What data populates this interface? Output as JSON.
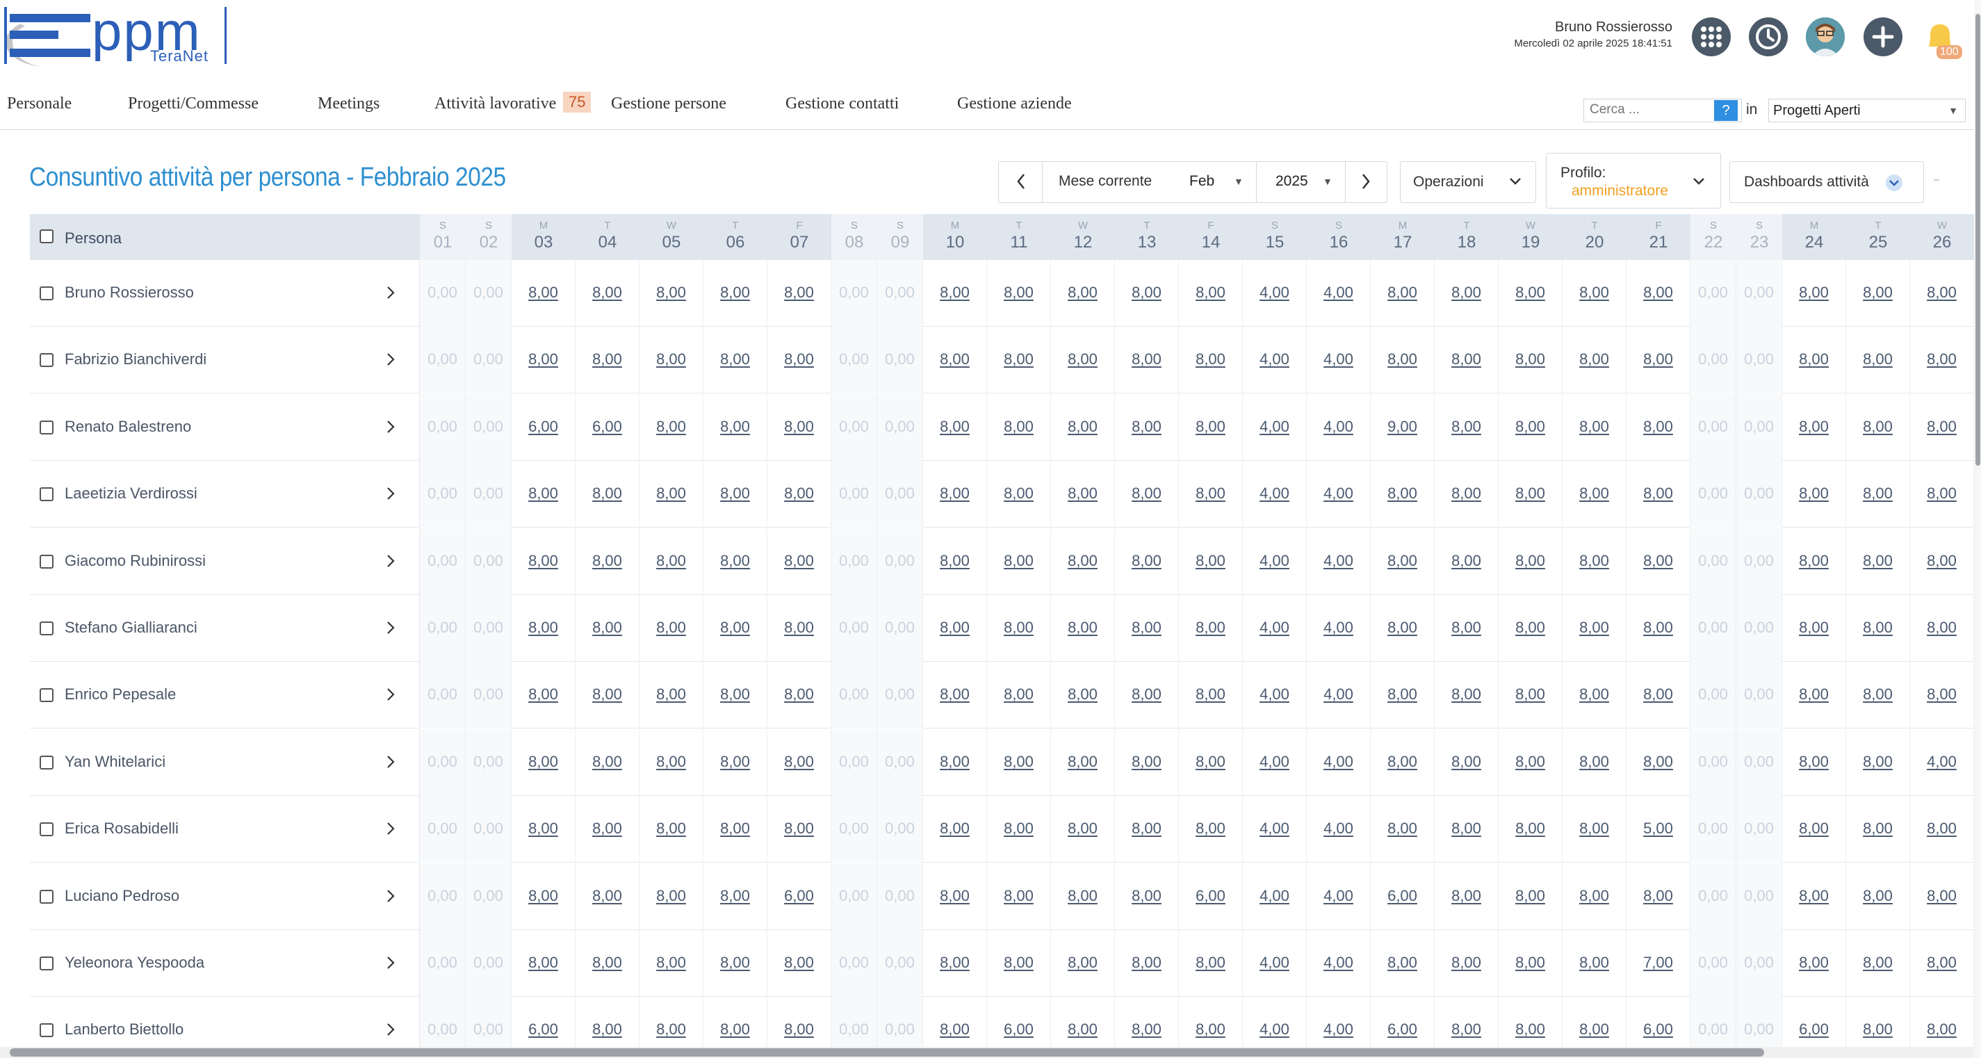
{
  "header": {
    "logo_text": "ppm",
    "logo_sub": "TeraNet",
    "user_name": "Bruno Rossierosso",
    "user_datetime": "Mercoledì 02 aprile 2025 18:41:51",
    "notifications_count": "100"
  },
  "nav": {
    "items": [
      "Personale",
      "Progetti/Commesse",
      "Meetings",
      "Attività lavorative",
      "Gestione persone",
      "Gestione contatti",
      "Gestione aziende"
    ],
    "attivita_badge": "75",
    "search_placeholder": "Cerca ...",
    "help_label": "?",
    "in_label": "in",
    "scope_selected": "Progetti Aperti"
  },
  "page": {
    "title": "Consuntivo attività per persona - Febbraio 2025",
    "current_month_label": "Mese corrente",
    "month": "Feb",
    "year": "2025",
    "operations_label": "Operazioni",
    "profile_label": "Profilo:",
    "profile_value": "amministratore",
    "dashboards_label": "Dashboards attività"
  },
  "grid": {
    "persona_header": "Persona",
    "days": [
      {
        "l": "S",
        "n": "01",
        "we": true
      },
      {
        "l": "S",
        "n": "02",
        "we": true
      },
      {
        "l": "M",
        "n": "03"
      },
      {
        "l": "T",
        "n": "04"
      },
      {
        "l": "W",
        "n": "05"
      },
      {
        "l": "T",
        "n": "06"
      },
      {
        "l": "F",
        "n": "07"
      },
      {
        "l": "S",
        "n": "08",
        "we": true
      },
      {
        "l": "S",
        "n": "09",
        "we": true
      },
      {
        "l": "M",
        "n": "10"
      },
      {
        "l": "T",
        "n": "11"
      },
      {
        "l": "W",
        "n": "12"
      },
      {
        "l": "T",
        "n": "13"
      },
      {
        "l": "F",
        "n": "14"
      },
      {
        "l": "S",
        "n": "15",
        "sat": true
      },
      {
        "l": "S",
        "n": "16",
        "sat": true
      },
      {
        "l": "M",
        "n": "17"
      },
      {
        "l": "T",
        "n": "18"
      },
      {
        "l": "W",
        "n": "19"
      },
      {
        "l": "T",
        "n": "20"
      },
      {
        "l": "F",
        "n": "21"
      },
      {
        "l": "S",
        "n": "22",
        "we": true
      },
      {
        "l": "S",
        "n": "23",
        "we": true
      },
      {
        "l": "M",
        "n": "24"
      },
      {
        "l": "T",
        "n": "25"
      },
      {
        "l": "W",
        "n": "26"
      }
    ],
    "rows": [
      {
        "name": "Bruno Rossierosso",
        "v": [
          "0,00",
          "0,00",
          "8,00",
          "8,00",
          "8,00",
          "8,00",
          "8,00",
          "0,00",
          "0,00",
          "8,00",
          "8,00",
          "8,00",
          "8,00",
          "8,00",
          "4,00",
          "4,00",
          "8,00",
          "8,00",
          "8,00",
          "8,00",
          "8,00",
          "0,00",
          "0,00",
          "8,00",
          "8,00",
          "8,00"
        ]
      },
      {
        "name": "Fabrizio Bianchiverdi",
        "v": [
          "0,00",
          "0,00",
          "8,00",
          "8,00",
          "8,00",
          "8,00",
          "8,00",
          "0,00",
          "0,00",
          "8,00",
          "8,00",
          "8,00",
          "8,00",
          "8,00",
          "4,00",
          "4,00",
          "8,00",
          "8,00",
          "8,00",
          "8,00",
          "8,00",
          "0,00",
          "0,00",
          "8,00",
          "8,00",
          "8,00"
        ]
      },
      {
        "name": "Renato Balestreno",
        "v": [
          "0,00",
          "0,00",
          "6,00",
          "6,00",
          "8,00",
          "8,00",
          "8,00",
          "0,00",
          "0,00",
          "8,00",
          "8,00",
          "8,00",
          "8,00",
          "8,00",
          "4,00",
          "4,00",
          "9,00",
          "8,00",
          "8,00",
          "8,00",
          "8,00",
          "0,00",
          "0,00",
          "8,00",
          "8,00",
          "8,00"
        ]
      },
      {
        "name": "Laeetizia Verdirossi",
        "v": [
          "0,00",
          "0,00",
          "8,00",
          "8,00",
          "8,00",
          "8,00",
          "8,00",
          "0,00",
          "0,00",
          "8,00",
          "8,00",
          "8,00",
          "8,00",
          "8,00",
          "4,00",
          "4,00",
          "8,00",
          "8,00",
          "8,00",
          "8,00",
          "8,00",
          "0,00",
          "0,00",
          "8,00",
          "8,00",
          "8,00"
        ]
      },
      {
        "name": "Giacomo Rubinirossi",
        "v": [
          "0,00",
          "0,00",
          "8,00",
          "8,00",
          "8,00",
          "8,00",
          "8,00",
          "0,00",
          "0,00",
          "8,00",
          "8,00",
          "8,00",
          "8,00",
          "8,00",
          "4,00",
          "4,00",
          "8,00",
          "8,00",
          "8,00",
          "8,00",
          "8,00",
          "0,00",
          "0,00",
          "8,00",
          "8,00",
          "8,00"
        ]
      },
      {
        "name": "Stefano Gialliaranci",
        "v": [
          "0,00",
          "0,00",
          "8,00",
          "8,00",
          "8,00",
          "8,00",
          "8,00",
          "0,00",
          "0,00",
          "8,00",
          "8,00",
          "8,00",
          "8,00",
          "8,00",
          "4,00",
          "4,00",
          "8,00",
          "8,00",
          "8,00",
          "8,00",
          "8,00",
          "0,00",
          "0,00",
          "8,00",
          "8,00",
          "8,00"
        ]
      },
      {
        "name": "Enrico Pepesale",
        "v": [
          "0,00",
          "0,00",
          "8,00",
          "8,00",
          "8,00",
          "8,00",
          "8,00",
          "0,00",
          "0,00",
          "8,00",
          "8,00",
          "8,00",
          "8,00",
          "8,00",
          "4,00",
          "4,00",
          "8,00",
          "8,00",
          "8,00",
          "8,00",
          "8,00",
          "0,00",
          "0,00",
          "8,00",
          "8,00",
          "8,00"
        ]
      },
      {
        "name": "Yan Whitelarici",
        "v": [
          "0,00",
          "0,00",
          "8,00",
          "8,00",
          "8,00",
          "8,00",
          "8,00",
          "0,00",
          "0,00",
          "8,00",
          "8,00",
          "8,00",
          "8,00",
          "8,00",
          "4,00",
          "4,00",
          "8,00",
          "8,00",
          "8,00",
          "8,00",
          "8,00",
          "0,00",
          "0,00",
          "8,00",
          "8,00",
          "4,00"
        ]
      },
      {
        "name": "Erica Rosabidelli",
        "v": [
          "0,00",
          "0,00",
          "8,00",
          "8,00",
          "8,00",
          "8,00",
          "8,00",
          "0,00",
          "0,00",
          "8,00",
          "8,00",
          "8,00",
          "8,00",
          "8,00",
          "4,00",
          "4,00",
          "8,00",
          "8,00",
          "8,00",
          "8,00",
          "5,00",
          "0,00",
          "0,00",
          "8,00",
          "8,00",
          "8,00"
        ]
      },
      {
        "name": "Luciano Pedroso",
        "v": [
          "0,00",
          "0,00",
          "8,00",
          "8,00",
          "8,00",
          "8,00",
          "6,00",
          "0,00",
          "0,00",
          "8,00",
          "8,00",
          "8,00",
          "8,00",
          "6,00",
          "4,00",
          "4,00",
          "6,00",
          "8,00",
          "8,00",
          "8,00",
          "8,00",
          "0,00",
          "0,00",
          "8,00",
          "8,00",
          "8,00"
        ]
      },
      {
        "name": "Yeleonora Yespooda",
        "v": [
          "0,00",
          "0,00",
          "8,00",
          "8,00",
          "8,00",
          "8,00",
          "8,00",
          "0,00",
          "0,00",
          "8,00",
          "8,00",
          "8,00",
          "8,00",
          "8,00",
          "4,00",
          "4,00",
          "8,00",
          "8,00",
          "8,00",
          "8,00",
          "7,00",
          "0,00",
          "0,00",
          "8,00",
          "8,00",
          "8,00"
        ]
      },
      {
        "name": "Lanberto Biettollo",
        "v": [
          "0,00",
          "0,00",
          "6,00",
          "8,00",
          "8,00",
          "8,00",
          "8,00",
          "0,00",
          "0,00",
          "8,00",
          "6,00",
          "8,00",
          "8,00",
          "8,00",
          "4,00",
          "4,00",
          "6,00",
          "8,00",
          "8,00",
          "8,00",
          "6,00",
          "0,00",
          "0,00",
          "6,00",
          "8,00",
          "8,00"
        ]
      }
    ]
  }
}
